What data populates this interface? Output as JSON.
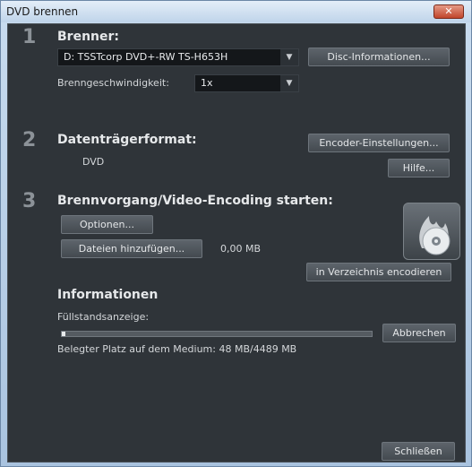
{
  "window": {
    "title": "DVD brennen",
    "close_glyph": "✕"
  },
  "section1": {
    "number": "1",
    "heading": "Brenner:",
    "burner_value": "D: TSSTcorp DVD+-RW TS-H653H",
    "disc_info_button": "Disc-Informationen...",
    "speed_label": "Brenngeschwindigkeit:",
    "speed_value": "1x"
  },
  "section2": {
    "number": "2",
    "heading": "Datenträgerformat:",
    "format_value": "DVD",
    "encoder_button": "Encoder-Einstellungen...",
    "help_button": "Hilfe..."
  },
  "section3": {
    "number": "3",
    "heading": "Brennvorgang/Video-Encoding starten:",
    "options_button": "Optionen...",
    "add_files_button": "Dateien hinzufügen...",
    "size_value": "0,00 MB",
    "encode_dir_button": "in Verzeichnis encodieren",
    "burn_icon": "disc-flame-icon"
  },
  "info": {
    "heading": "Informationen",
    "fill_label": "Füllstandsanzeige:",
    "fill_fraction": 0.011,
    "cancel_button": "Abbrechen",
    "used_space": "Belegter Platz auf dem Medium: 48 MB/4489 MB"
  },
  "footer": {
    "close_button": "Schließen"
  },
  "colors": {
    "panel": "#2f3439",
    "title_bar": "#bfd4ea",
    "close": "#c0452b"
  }
}
